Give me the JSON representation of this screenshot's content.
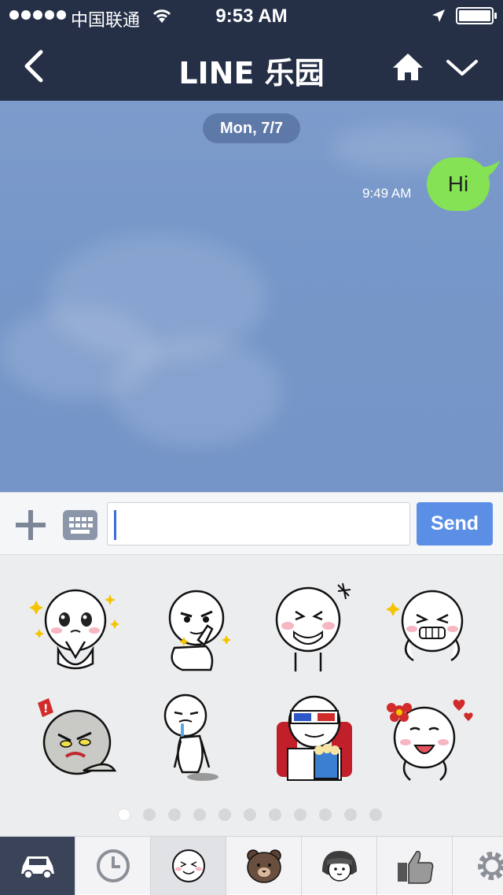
{
  "status_bar": {
    "carrier": "中国联通",
    "time": "9:53 AM"
  },
  "nav": {
    "title": "LINE 乐园"
  },
  "chat": {
    "date_label": "Mon, 7/7",
    "messages": [
      {
        "text": "Hi",
        "time": "9:49 AM",
        "sender": "self"
      }
    ]
  },
  "composer": {
    "input_value": "",
    "send_label": "Send"
  },
  "stickers": {
    "items": [
      "sticker-1",
      "sticker-2",
      "sticker-3",
      "sticker-4",
      "sticker-5",
      "sticker-6",
      "sticker-7",
      "sticker-8"
    ],
    "page_count": 11,
    "current_page": 1
  },
  "colors": {
    "bar_dark": "#253047",
    "bubble_green": "#85e254",
    "send_blue": "#5b8fe6"
  },
  "tabs": [
    {
      "icon": "car-icon",
      "selected": true
    },
    {
      "icon": "clock-icon",
      "selected": false
    },
    {
      "icon": "moon-face-icon",
      "selected": false
    },
    {
      "icon": "bear-icon",
      "selected": false
    },
    {
      "icon": "girl-icon",
      "selected": false
    },
    {
      "icon": "thumbs-up-icon",
      "selected": false
    },
    {
      "icon": "gear-icon",
      "selected": false
    }
  ]
}
